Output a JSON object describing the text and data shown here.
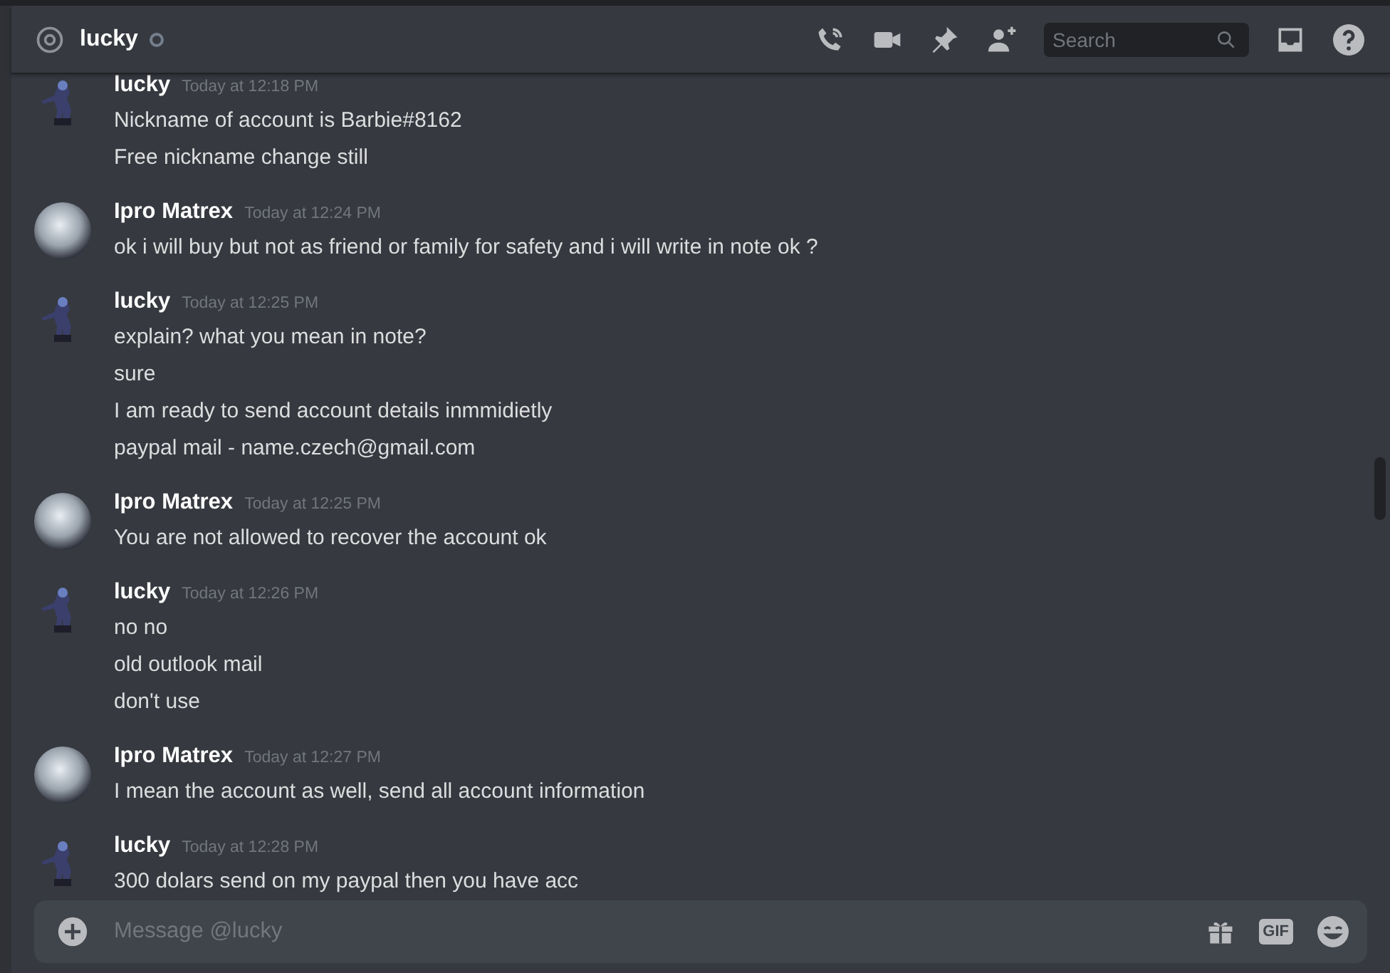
{
  "header": {
    "channel": "lucky",
    "online": false,
    "search": {
      "placeholder": "Search"
    }
  },
  "messages": [
    {
      "author": "lucky",
      "kind": "figure",
      "time": "Today at 12:18 PM",
      "lines": [
        "Nickname of account is Barbie#8162",
        "Free nickname change still"
      ]
    },
    {
      "author": "Ipro Matrex",
      "kind": "photo",
      "time": "Today at 12:24 PM",
      "lines": [
        "ok i will buy but not as friend or family for safety and i will write in note ok ?"
      ]
    },
    {
      "author": "lucky",
      "kind": "figure",
      "time": "Today at 12:25 PM",
      "lines": [
        "explain? what you mean in note?",
        "sure",
        "I am ready to send account details inmmidietly",
        "paypal mail - name.czech@gmail.com"
      ]
    },
    {
      "author": "Ipro Matrex",
      "kind": "photo",
      "time": "Today at 12:25 PM",
      "lines": [
        "You are not allowed to recover the account ok"
      ]
    },
    {
      "author": "lucky",
      "kind": "figure",
      "time": "Today at 12:26 PM",
      "lines": [
        "no no",
        "old outlook mail",
        "don't use"
      ]
    },
    {
      "author": "Ipro Matrex",
      "kind": "photo",
      "time": "Today at 12:27 PM",
      "lines": [
        "I mean the account as well, send all account information"
      ]
    },
    {
      "author": "lucky",
      "kind": "figure",
      "time": "Today at 12:28 PM",
      "lines": [
        "300 dolars send on my paypal then you have acc"
      ]
    }
  ],
  "composer": {
    "placeholder": "Message @lucky",
    "gif": "GIF"
  }
}
